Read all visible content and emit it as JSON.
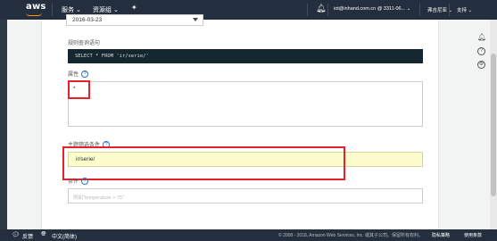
{
  "nav": {
    "logo": "aws",
    "services": "服务 ⌄",
    "resource_groups": "资源组 ⌄",
    "account": "iot@inhand.com.cn @ 3311-06... ⌄",
    "region": "弗吉尼亚 ⌄",
    "support": "支持 ⌄"
  },
  "form": {
    "date_value": "2016-03-23",
    "sql_label": "规则查询语句",
    "sql_value": "SELECT * FROM 'ir/serie/'",
    "attr_label": "属性",
    "attr_value": "*",
    "topic_label": "主题筛选条件",
    "topic_value": "ir/serie/",
    "cond_label": "条件",
    "cond_placeholder": "例如\"temperature > 75\""
  },
  "footer": {
    "feedback": "反馈",
    "language": "中文(简体)",
    "copyright": "© 2008 - 2018, Amazon Web Services, Inc. 或其子公司。保留所有权利。",
    "privacy": "隐私策略",
    "terms": "使用条款"
  },
  "icons": {
    "bell": "bell-icon",
    "pin": "pin-icon",
    "help": "help-icon",
    "settings": "settings-icon"
  }
}
